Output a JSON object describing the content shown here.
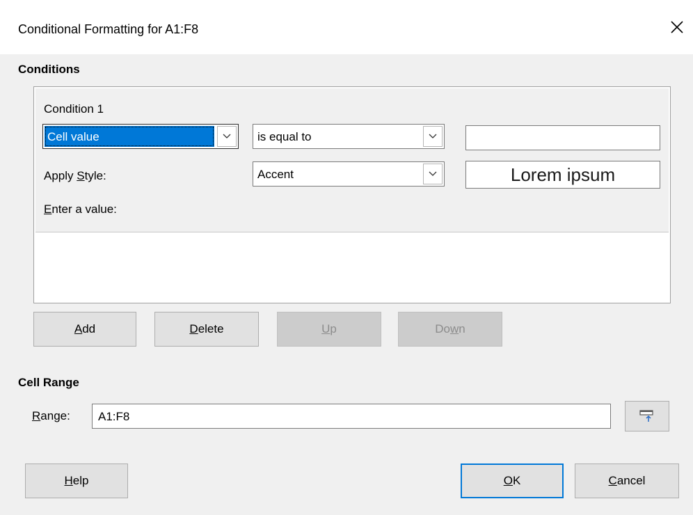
{
  "window": {
    "title": "Conditional Formatting for A1:F8"
  },
  "conditions": {
    "heading": "Conditions",
    "condition_label": "Condition 1",
    "type_select": "Cell value",
    "operator_select": "is equal to",
    "value_input": "",
    "apply_style_label": "Apply Style:",
    "style_select": "Accent",
    "preview_text": "Lorem ipsum",
    "enter_value_label": "Enter a value:"
  },
  "buttons": {
    "add": "Add",
    "delete": "Delete",
    "up": "Up",
    "down": "Down",
    "help": "Help",
    "ok": "OK",
    "cancel": "Cancel"
  },
  "cell_range": {
    "heading": "Cell Range",
    "range_label": "Range:",
    "range_value": "A1:F8"
  },
  "colors": {
    "selection": "#0078d7",
    "dialog_bg": "#f0f0f0",
    "default_button_border": "#0078d7"
  },
  "icons": {
    "close": "close-icon",
    "dropdown": "chevron-down-icon",
    "shrink": "shrink-dialog-icon"
  }
}
